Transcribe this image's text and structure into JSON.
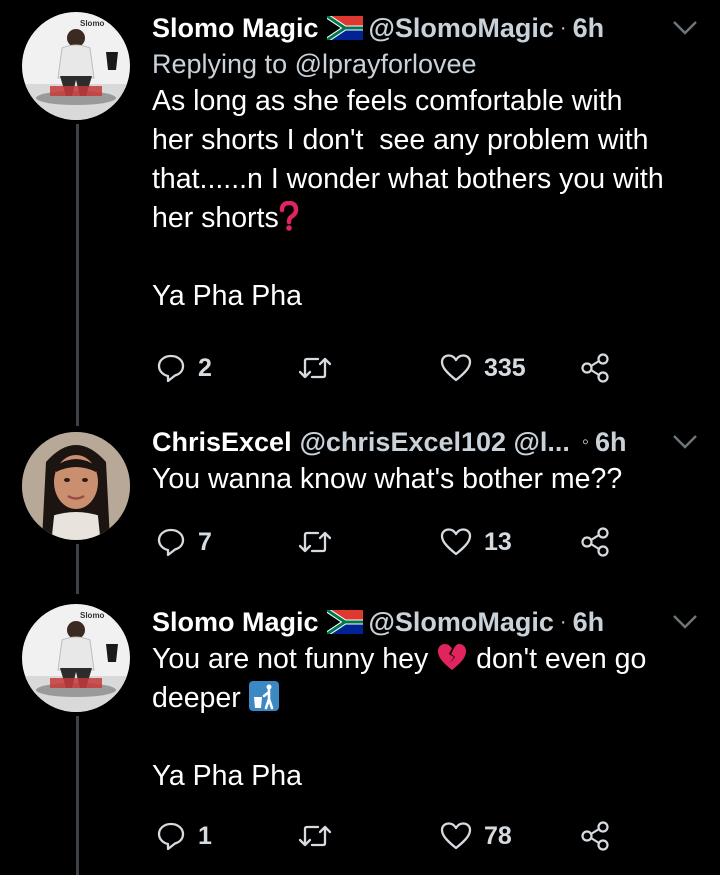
{
  "tweets": [
    {
      "name": "Slomo Magic",
      "handle": "@SlomoMagic",
      "dot": "·",
      "time": "6h",
      "reply_to": "Replying to @lprayforlovee",
      "body": "As long as she feels comfortable with\nher shorts I don't  see any problem with\nthat......n I wonder what bothers you with\nher shorts",
      "body_tail": "\n\nYa Pha Pha",
      "replies": "2",
      "likes": "335",
      "avatar_text": "Slomo"
    },
    {
      "name": "ChrisExcel",
      "handle": "@chrisExcel102 @l...",
      "dot": "◦",
      "time": "6h",
      "body": "You wanna know what's bother me??",
      "replies": "7",
      "likes": "13"
    },
    {
      "name": "Slomo Magic",
      "handle": "@SlomoMagic",
      "dot": "·",
      "time": "6h",
      "body_a": "You are not funny hey ",
      "body_b": " don't even go\ndeeper ",
      "body_tail": "\n\nYa Pha Pha",
      "replies": "1",
      "likes": "78",
      "avatar_text": "Slomo"
    }
  ],
  "icons": [
    "reply-icon",
    "retweet-icon",
    "like-icon",
    "share-icon",
    "caret-down-icon",
    "flag-south-africa-icon",
    "question-mark-icon",
    "broken-heart-icon",
    "litter-bin-icon"
  ],
  "colors": {
    "background": "#000000",
    "text": "#ffffff",
    "secondary": "#c9d1d9",
    "thread_line": "#3d4148",
    "emoji_red": "#e0245e",
    "emoji_blue": "#3b88c3"
  }
}
